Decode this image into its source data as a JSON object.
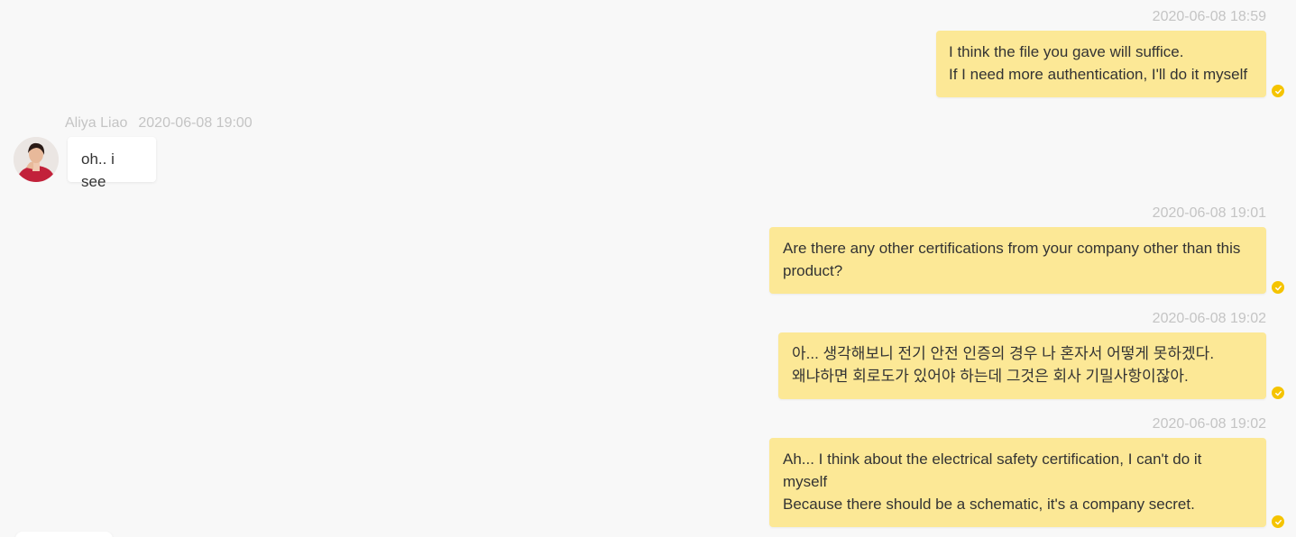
{
  "colors": {
    "background": "#f8f8f8",
    "outgoing_bubble": "#fce896",
    "incoming_bubble": "#ffffff",
    "timestamp": "#c4c4c4",
    "read_check": "#f5c400"
  },
  "messages": [
    {
      "direction": "outgoing",
      "timestamp": "2020-06-08 18:59",
      "text": "I think the file you gave will suffice.\nIf I need more authentication, I'll do it myself",
      "status_icon": "read-check-icon"
    },
    {
      "direction": "incoming",
      "sender": "Aliya Liao",
      "timestamp": "2020-06-08 19:00",
      "text": "oh.. i see",
      "avatar": "avatar-image"
    },
    {
      "direction": "outgoing",
      "timestamp": "2020-06-08 19:01",
      "text": "Are there any other certifications from your company other than this\nproduct?",
      "status_icon": "read-check-icon"
    },
    {
      "direction": "outgoing",
      "timestamp": "2020-06-08 19:02",
      "text": "아... 생각해보니 전기 안전 인증의 경우 나 혼자서 어떻게 못하겠다.\n왜냐하면 회로도가 있어야 하는데 그것은 회사 기밀사항이잖아.",
      "status_icon": "read-check-icon"
    },
    {
      "direction": "outgoing",
      "timestamp": "2020-06-08 19:02",
      "text": "Ah... I think about the electrical safety certification, I can't do it\nmyself\nBecause there should be a schematic, it's a company secret.",
      "status_icon": "read-check-icon"
    }
  ]
}
